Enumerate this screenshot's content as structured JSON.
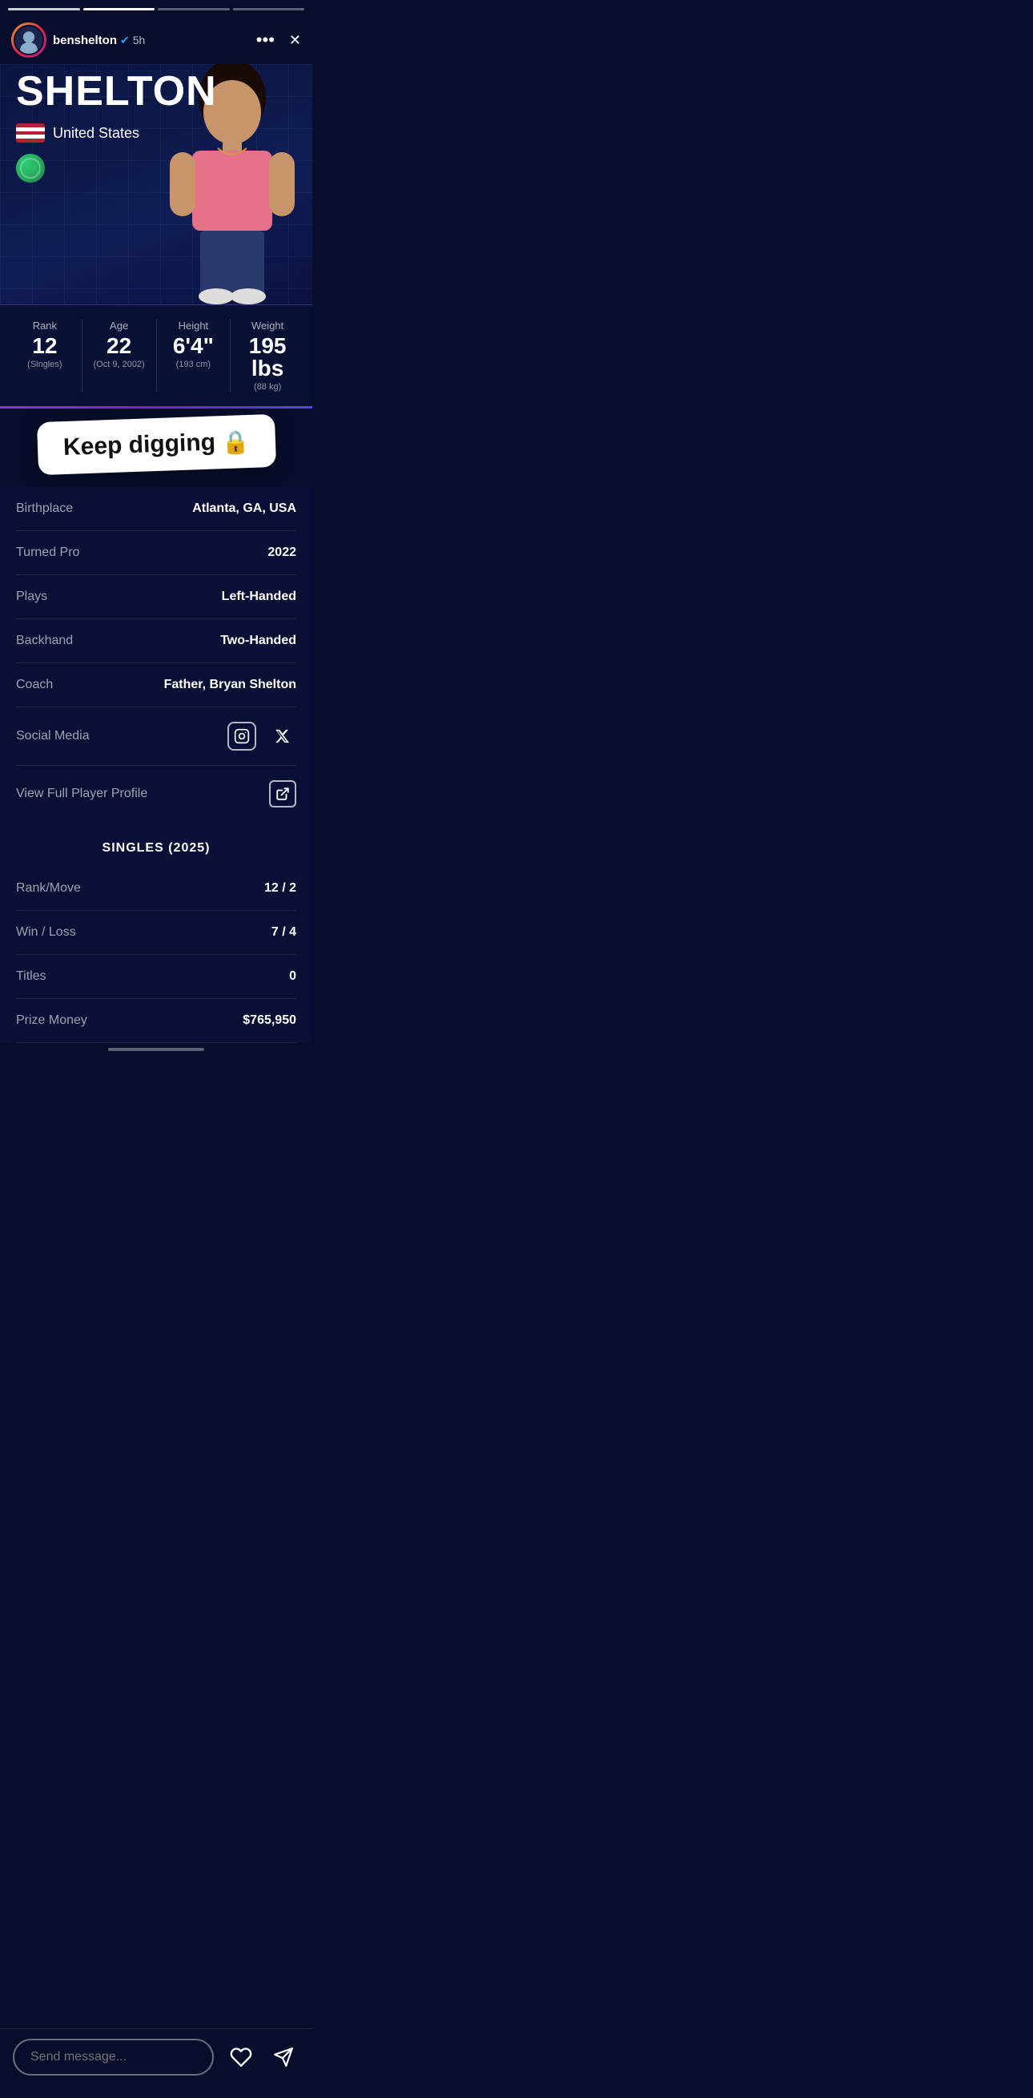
{
  "stories": {
    "segments": 4,
    "active_index": 1
  },
  "header": {
    "username": "benshelton",
    "verified": true,
    "time_ago": "5h",
    "more_label": "•••",
    "close_label": "✕"
  },
  "hero": {
    "player_last_name": "SHELTON",
    "country": "United States",
    "stats": {
      "rank": {
        "label": "Rank",
        "value": "12",
        "sub": "(Singles)"
      },
      "age": {
        "label": "Age",
        "value": "22",
        "sub": "(Oct 9, 2002)"
      },
      "height": {
        "label": "Height",
        "value": "6'4\"",
        "sub": "(193 cm)"
      },
      "weight": {
        "label": "Weight",
        "value": "195 lbs",
        "sub": "(88 kg)"
      }
    }
  },
  "keep_digging": {
    "text": "Keep digging",
    "emoji": "🔒"
  },
  "info": {
    "rows": [
      {
        "label": "Birthplace",
        "value": "Atlanta, GA, USA"
      },
      {
        "label": "Turned Pro",
        "value": "2022"
      },
      {
        "label": "Plays",
        "value": "Left-Handed"
      },
      {
        "label": "Backhand",
        "value": "Two-Handed"
      },
      {
        "label": "Coach",
        "value": "Father, Bryan Shelton"
      },
      {
        "label": "Social Media",
        "value": ""
      },
      {
        "label": "View Full Player Profile",
        "value": ""
      }
    ]
  },
  "singles": {
    "header": "SINGLES (2025)",
    "rows": [
      {
        "label": "Rank/Move",
        "value": "12 / 2"
      },
      {
        "label": "Win / Loss",
        "value": "7 / 4"
      },
      {
        "label": "Titles",
        "value": "0"
      },
      {
        "label": "Prize Money",
        "value": "$765,950"
      }
    ]
  },
  "bottom": {
    "placeholder": "Send message...",
    "like_icon": "♡",
    "share_icon": "➤"
  }
}
